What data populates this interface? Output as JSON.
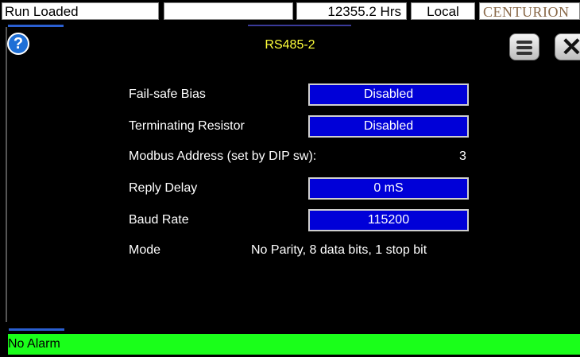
{
  "topbar": {
    "status": "Run Loaded",
    "hours": "12355.2 Hrs",
    "mode": "Local",
    "brand": "CENTURION"
  },
  "dialog": {
    "title": "RS485-2",
    "help_glyph": "?",
    "close_glyph": "✕"
  },
  "settings": {
    "failsafe_bias": {
      "label": "Fail-safe Bias",
      "value": "Disabled"
    },
    "terminating_resistor": {
      "label": "Terminating Resistor",
      "value": "Disabled"
    },
    "modbus_address": {
      "label": "Modbus Address (set by DIP sw):",
      "value": "3"
    },
    "reply_delay": {
      "label": "Reply Delay",
      "value": "0 mS"
    },
    "baud_rate": {
      "label": "Baud Rate",
      "value": "115200"
    },
    "mode": {
      "label": "Mode",
      "value": "No Parity, 8 data bits, 1 stop bit"
    }
  },
  "alarm": {
    "text": "No Alarm"
  },
  "colors": {
    "accent_blue": "#0000d8",
    "title_yellow": "#ffff3a",
    "alarm_green": "#1aff1a"
  }
}
